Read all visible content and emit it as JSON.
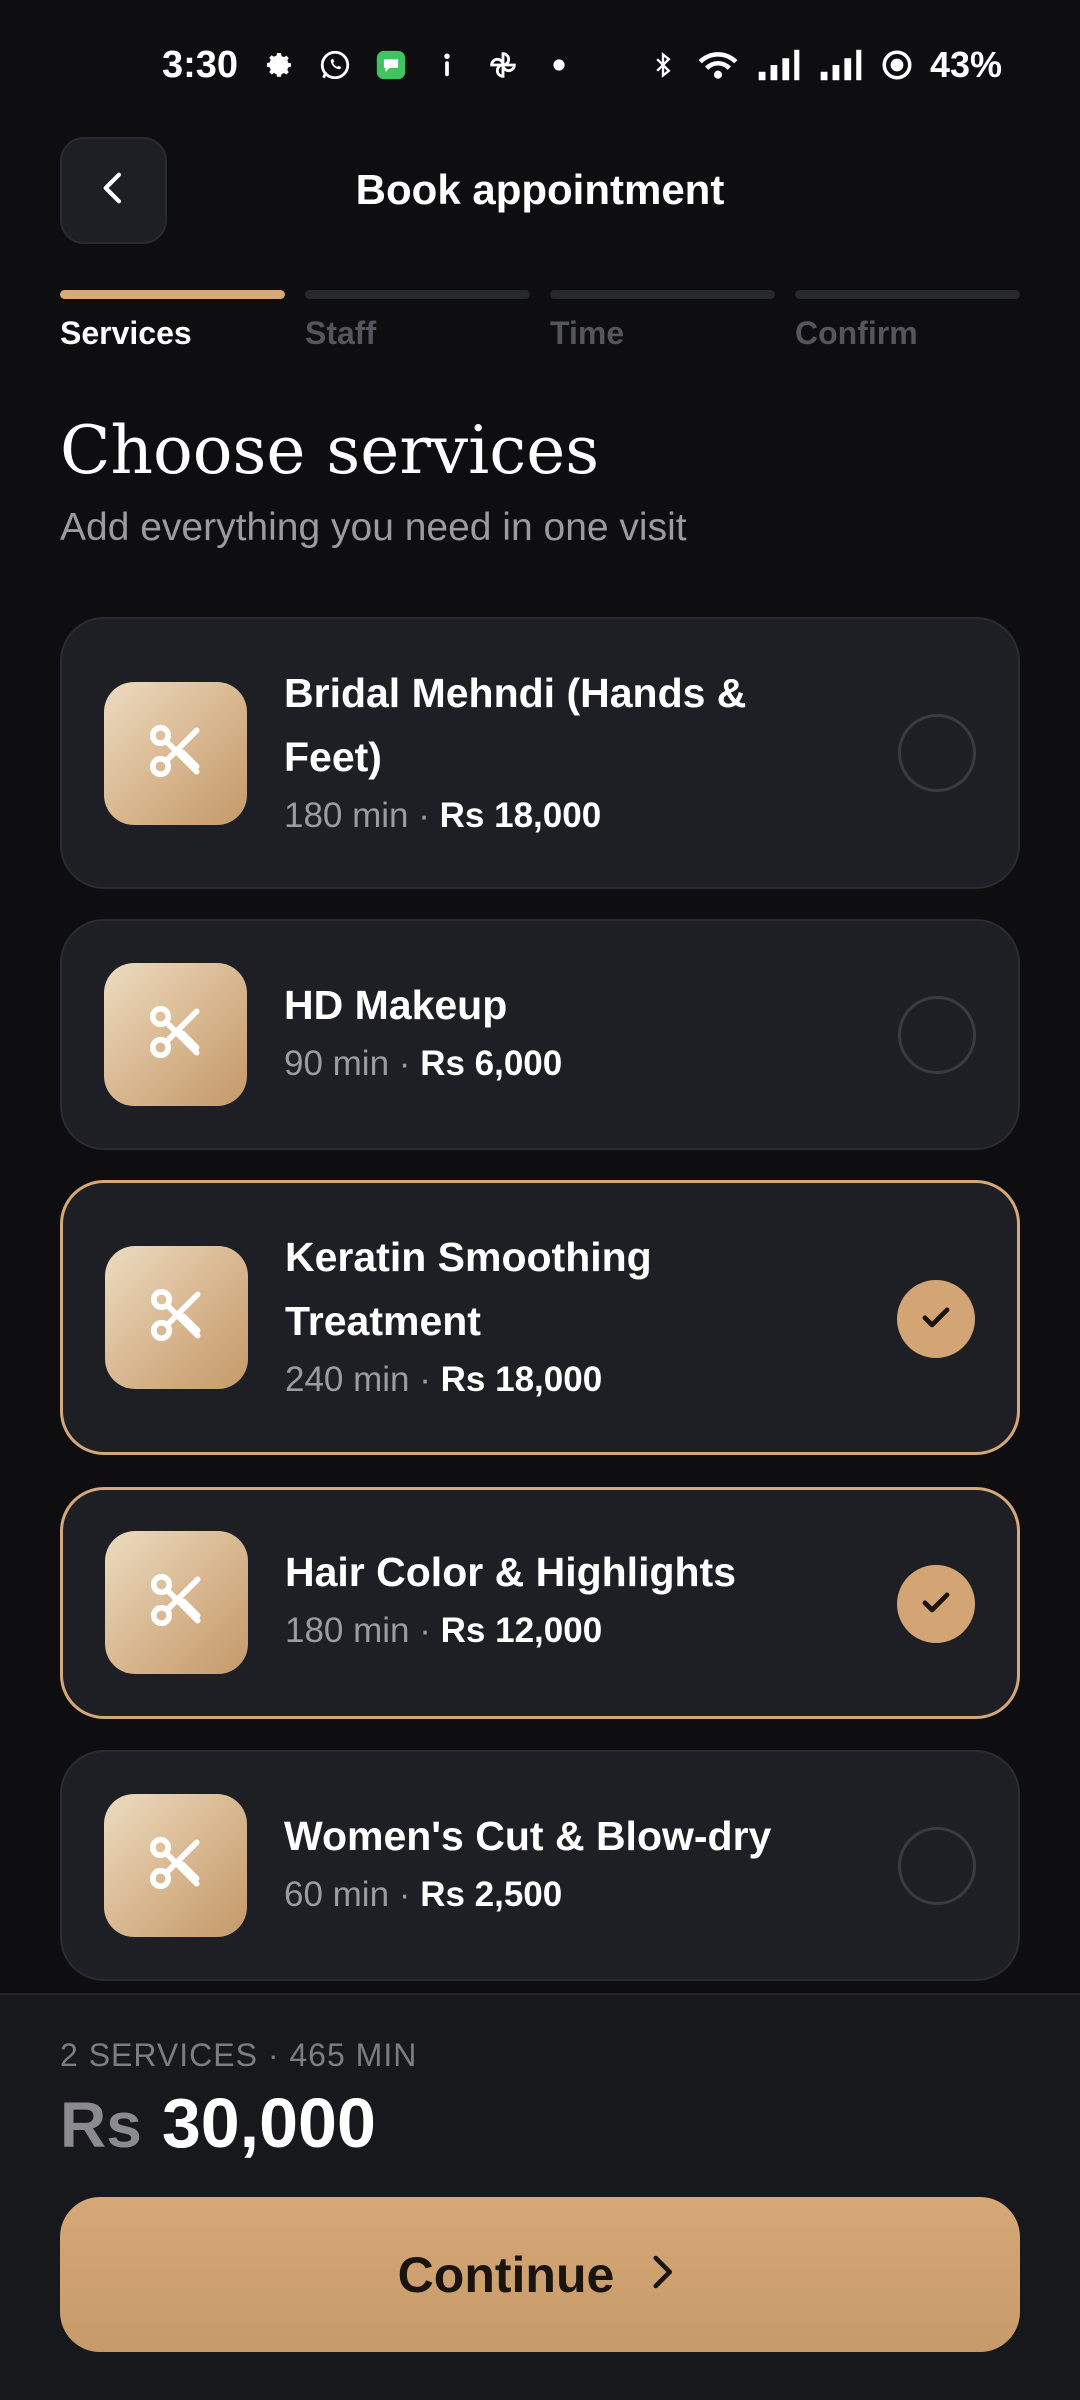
{
  "status_bar": {
    "time": "3:30",
    "battery": "43%",
    "left_icons": [
      "settings-icon",
      "whatsapp-icon",
      "messages-icon",
      "info-icon",
      "pinwheel-icon",
      "dot-icon"
    ],
    "right_icons": [
      "bluetooth-icon",
      "wifi-icon",
      "signal-icon",
      "signal-icon",
      "battery-ring-icon"
    ]
  },
  "header": {
    "title": "Book appointment",
    "back_icon": "chevron-left-icon"
  },
  "stepper": [
    {
      "label": "Services",
      "active": true
    },
    {
      "label": "Staff",
      "active": false
    },
    {
      "label": "Time",
      "active": false
    },
    {
      "label": "Confirm",
      "active": false
    }
  ],
  "heading": "Choose services",
  "subheading": "Add everything you need in one visit",
  "services": [
    {
      "name": "Bridal Mehndi (Hands & Feet)",
      "duration": "180 min",
      "separator": "·",
      "price": "Rs 18,000",
      "selected": false,
      "icon": "scissors-icon"
    },
    {
      "name": "HD Makeup",
      "duration": "90 min",
      "separator": "·",
      "price": "Rs 6,000",
      "selected": false,
      "icon": "scissors-icon"
    },
    {
      "name": "Keratin Smoothing Treatment",
      "duration": "240 min",
      "separator": "·",
      "price": "Rs 18,000",
      "selected": true,
      "icon": "scissors-icon"
    },
    {
      "name": "Hair Color & Highlights",
      "duration": "180 min",
      "separator": "·",
      "price": "Rs 12,000",
      "selected": true,
      "icon": "scissors-icon"
    },
    {
      "name": "Women's Cut & Blow-dry",
      "duration": "60 min",
      "separator": "·",
      "price": "Rs 2,500",
      "selected": false,
      "icon": "scissors-icon"
    }
  ],
  "footer": {
    "summary": "2 SERVICES · 465 MIN",
    "currency": "Rs",
    "total": "30,000",
    "continue_label": "Continue",
    "continue_icon": "chevron-right-icon"
  },
  "colors": {
    "accent": "#d4a574",
    "background": "#0e0e10",
    "card": "#1e1f24"
  }
}
